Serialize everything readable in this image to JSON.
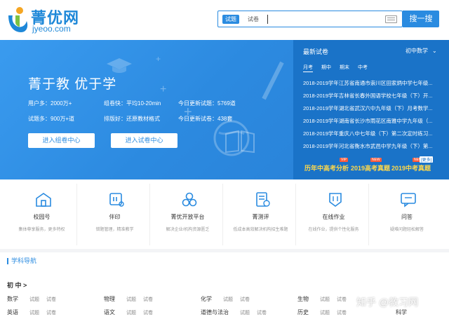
{
  "logo": {
    "cn": "菁优网",
    "en": "jyeoo.com"
  },
  "search": {
    "tabs": [
      "试题",
      "试卷"
    ],
    "button": "搜一搜"
  },
  "banner": {
    "slogan": "菁于教 优于学",
    "stats": [
      "用户多：2000万+",
      "组卷快：平均10-20min",
      "今日更新试题：5769道",
      "试题多：900万+道",
      "排版好：还原教材格式",
      "今日更新试卷：438套"
    ],
    "buttons": [
      "进入组卷中心",
      "进入试卷中心"
    ]
  },
  "news": {
    "title": "最新试卷",
    "grade": "初中数学",
    "tabs": [
      "月考",
      "期中",
      "期末",
      "中考"
    ],
    "items": [
      "2018-2019学年江苏省南通市崇川区田家炳中学七年级...",
      "2018-2019学年吉林省长春外国语学校七年级（下）开...",
      "2018-2019学年湖北省武汉六中九年级（下）月考数学...",
      "2018-2019学年湖南省长沙市雨花区南雅中学九年级（...",
      "2018-2019学年重庆八中七年级（下）第二次定时练习...",
      "2018-2019学年河北省衡水市武邑中学九年级（下）第..."
    ],
    "promos": [
      "历年中高考分析",
      "2019高考真题",
      "2019中考真题"
    ],
    "badges": [
      "VIP",
      "NEW",
      "NEW"
    ],
    "more": "[更多]"
  },
  "services": [
    {
      "name": "校园号",
      "desc": "集体尊享服务，更多特权"
    },
    {
      "name": "伴印",
      "desc": "错题管理，精准教学"
    },
    {
      "name": "菁优开放平台",
      "desc": "解决企业/机构资源匮乏"
    },
    {
      "name": "菁测评",
      "desc": "低成本高效解决机构招生难题"
    },
    {
      "name": "在线作业",
      "desc": "在线作业，提供个性化服务"
    },
    {
      "name": "问答",
      "desc": "疑难问题轻松解答"
    }
  ],
  "subject_nav": {
    "title": "学科导航",
    "level": "初 中 >",
    "subjects": [
      {
        "name": "数学",
        "links": [
          "试题",
          "试卷"
        ]
      },
      {
        "name": "物理",
        "links": [
          "试题",
          "试卷"
        ]
      },
      {
        "name": "化学",
        "links": [
          "试题",
          "试卷"
        ]
      },
      {
        "name": "生物",
        "links": [
          "试题",
          "试卷"
        ]
      },
      {
        "name": "英语",
        "links": [
          "试题",
          "试卷"
        ]
      },
      {
        "name": "语文",
        "links": [
          "试题",
          "试卷"
        ]
      },
      {
        "name": "道德与法治",
        "links": [
          "试题",
          "试卷"
        ]
      },
      {
        "name": "历史",
        "links": [
          "试题",
          "试卷"
        ]
      },
      {
        "name": "科学",
        "links": []
      }
    ]
  },
  "watermark": "知乎 @教习网",
  "colors": {
    "accent": "#2a8be0",
    "news_bg": "#1a73c8",
    "promo": "#ffd84a"
  }
}
